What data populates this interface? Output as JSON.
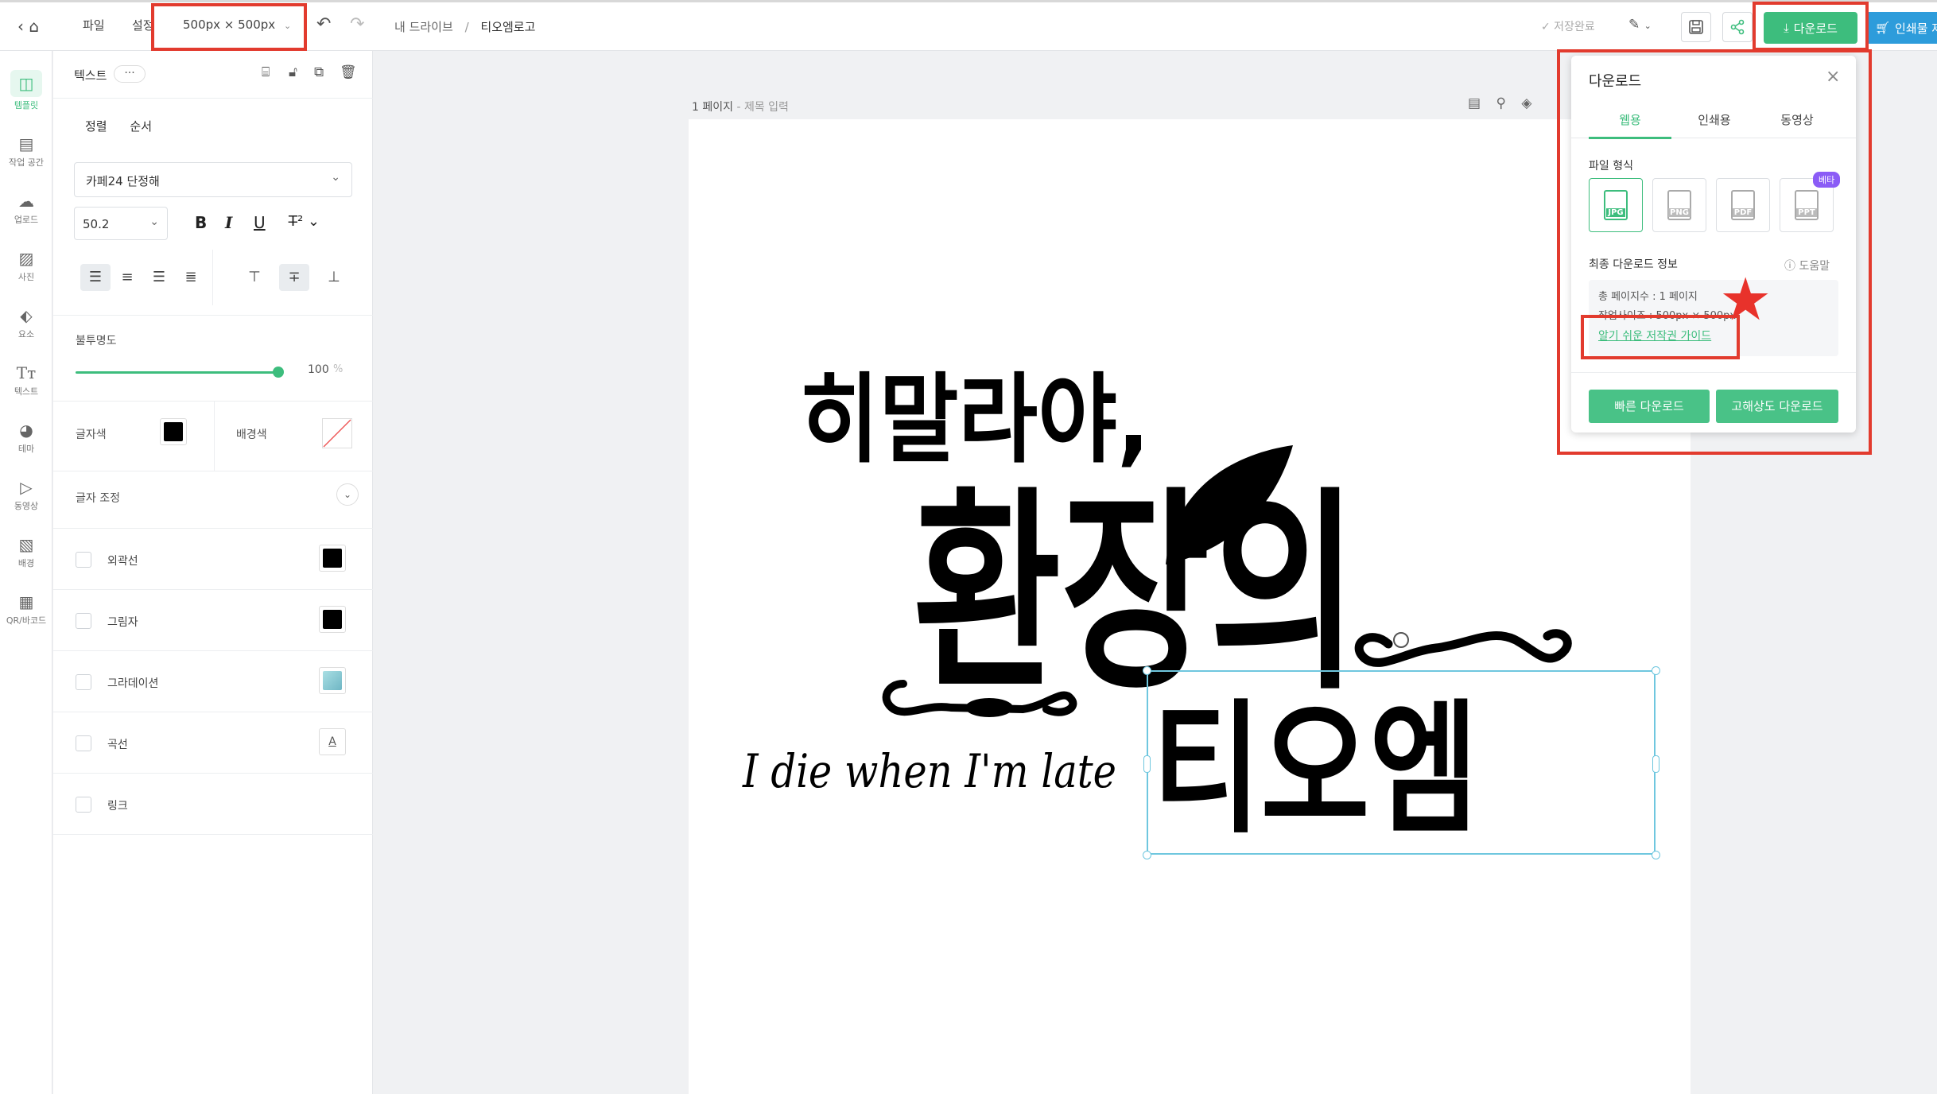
{
  "topbar": {
    "file_menu": "파일",
    "settings_menu": "설정",
    "canvas_size": "500px × 500px",
    "breadcrumb": {
      "root": "내 드라이브",
      "separator": "/",
      "current": "티오엠로고"
    },
    "save_status": "✓ 저장완료",
    "download_label": "다운로드",
    "print_order_label": "인쇄물 제"
  },
  "rail": {
    "items": [
      {
        "label": "템플릿",
        "icon": "template-icon",
        "active": true
      },
      {
        "label": "작업 공간",
        "icon": "workspace-icon"
      },
      {
        "label": "업로드",
        "icon": "upload-icon"
      },
      {
        "label": "사진",
        "icon": "photo-icon"
      },
      {
        "label": "요소",
        "icon": "elements-icon"
      },
      {
        "label": "텍스트",
        "icon": "text-icon"
      },
      {
        "label": "테마",
        "icon": "theme-icon"
      },
      {
        "label": "동영상",
        "icon": "video-icon"
      },
      {
        "label": "배경",
        "icon": "background-icon"
      },
      {
        "label": "QR/바코드",
        "icon": "qr-icon"
      }
    ]
  },
  "panel": {
    "title": "텍스트",
    "more": "···",
    "sub_tabs": [
      "정렬",
      "순서"
    ],
    "font_family": "카페24 단정해",
    "font_size": "50.2",
    "opacity_label": "불투명도",
    "opacity_value": "100",
    "opacity_unit": "%",
    "opacity_fraction": 1.0,
    "text_color_label": "글자색",
    "text_color": "#000000",
    "bg_color_label": "배경색",
    "char_adjust_label": "글자 조정",
    "options": [
      {
        "label": "외곽선",
        "swatch": "#000000"
      },
      {
        "label": "그림자",
        "swatch": "#000000"
      },
      {
        "label": "그라데이션",
        "swatch": "#8fd0d8"
      },
      {
        "label": "곡선",
        "swatch": "A"
      },
      {
        "label": "링크"
      }
    ]
  },
  "canvas": {
    "page_label": "1 페이지",
    "page_title_placeholder": "제목 입력",
    "art_line1": "히말라야,",
    "art_line2": "환장의",
    "art_line3": "티오엠",
    "art_tagline": "I die when I'm late"
  },
  "download_popover": {
    "title": "다운로드",
    "tabs": [
      "웹용",
      "인쇄용",
      "동영상"
    ],
    "file_format_label": "파일 형식",
    "formats": [
      "JPG",
      "PNG",
      "PDF",
      "PPT"
    ],
    "beta_badge": "베타",
    "final_info_label": "최종 다운로드 정보",
    "help_label": "도움말",
    "info_pages": "총 페이지수 : 1 페이지",
    "info_size": "작업사이즈 : 500px × 500px",
    "copyright_guide": "알기 쉬운 저작권 가이드",
    "quick_download": "빠른 다운로드",
    "hd_download": "고해상도 다운로드"
  },
  "colors": {
    "accent": "#3dbd7d",
    "annotation_red": "#e23b2e",
    "print_blue": "#2d9cdb",
    "beta_purple": "#8b5cf6"
  }
}
